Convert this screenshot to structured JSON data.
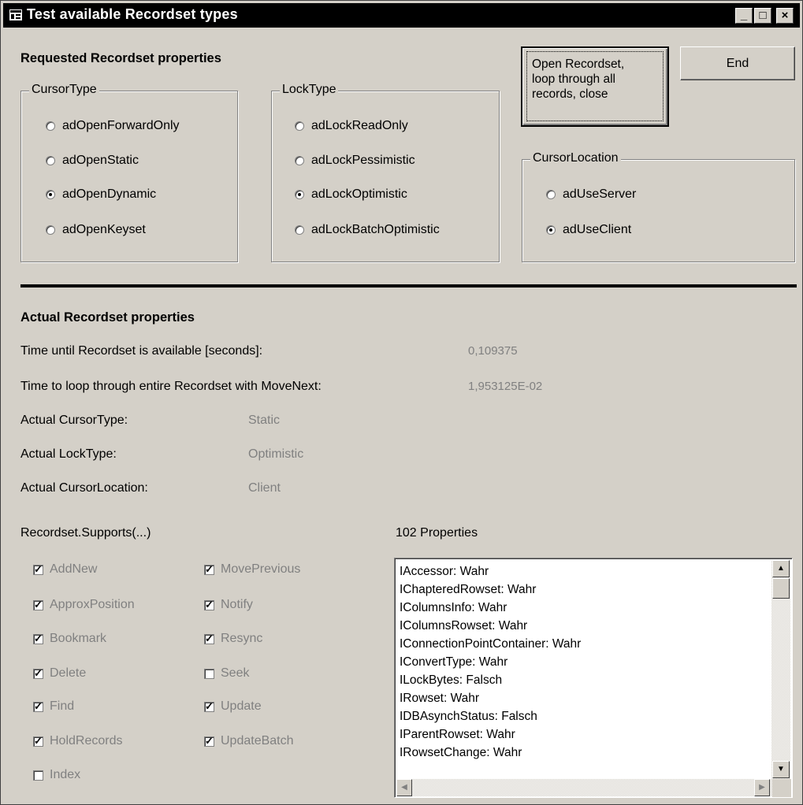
{
  "window": {
    "title": "Test available Recordset types",
    "controls": {
      "minimize": "_",
      "maximize": "□",
      "close": "×"
    }
  },
  "requested": {
    "heading": "Requested Recordset properties",
    "cursor_type": {
      "label": "CursorType",
      "options": [
        {
          "label": "adOpenForwardOnly",
          "selected": false
        },
        {
          "label": "adOpenStatic",
          "selected": false
        },
        {
          "label": "adOpenDynamic",
          "selected": true
        },
        {
          "label": "adOpenKeyset",
          "selected": false
        }
      ]
    },
    "lock_type": {
      "label": "LockType",
      "options": [
        {
          "label": "adLockReadOnly",
          "selected": false
        },
        {
          "label": "adLockPessimistic",
          "selected": false
        },
        {
          "label": "adLockOptimistic",
          "selected": true
        },
        {
          "label": "adLockBatchOptimistic",
          "selected": false
        }
      ]
    },
    "cursor_location": {
      "label": "CursorLocation",
      "options": [
        {
          "label": "adUseServer",
          "selected": false
        },
        {
          "label": "adUseClient",
          "selected": true
        }
      ]
    }
  },
  "buttons": {
    "open_line1": "Open Recordset,",
    "open_line2": "loop through all",
    "open_line3": "records, close",
    "end": "End"
  },
  "actual": {
    "heading": "Actual Recordset properties",
    "time_available_label": "Time until Recordset is available [seconds]:",
    "time_available_value": "0,109375",
    "time_loop_label": "Time to loop through entire Recordset with MoveNext:",
    "time_loop_value": "1,953125E-02",
    "cursor_type_label": "Actual CursorType:",
    "cursor_type_value": "Static",
    "lock_type_label": "Actual LockType:",
    "lock_type_value": "Optimistic",
    "cursor_location_label": "Actual CursorLocation:",
    "cursor_location_value": "Client"
  },
  "supports": {
    "label": "Recordset.Supports(...)",
    "items": [
      {
        "label": "AddNew",
        "checked": true
      },
      {
        "label": "ApproxPosition",
        "checked": true
      },
      {
        "label": "Bookmark",
        "checked": true
      },
      {
        "label": "Delete",
        "checked": true
      },
      {
        "label": "Find",
        "checked": true
      },
      {
        "label": "HoldRecords",
        "checked": true
      },
      {
        "label": "Index",
        "checked": false
      },
      {
        "label": "MovePrevious",
        "checked": true
      },
      {
        "label": "Notify",
        "checked": true
      },
      {
        "label": "Resync",
        "checked": true
      },
      {
        "label": "Seek",
        "checked": false
      },
      {
        "label": "Update",
        "checked": true
      },
      {
        "label": "UpdateBatch",
        "checked": true
      }
    ]
  },
  "properties": {
    "label": "102 Properties",
    "items": [
      "IAccessor: Wahr",
      "IChapteredRowset: Wahr",
      "IColumnsInfo: Wahr",
      "IColumnsRowset: Wahr",
      "IConnectionPointContainer: Wahr",
      "IConvertType: Wahr",
      "ILockBytes: Falsch",
      "IRowset: Wahr",
      "IDBAsynchStatus: Falsch",
      "IParentRowset: Wahr",
      "IRowsetChange: Wahr"
    ]
  },
  "colors": {
    "face": "#d4d0c8",
    "title_bar": "#000000",
    "disabled_text": "#808080"
  }
}
